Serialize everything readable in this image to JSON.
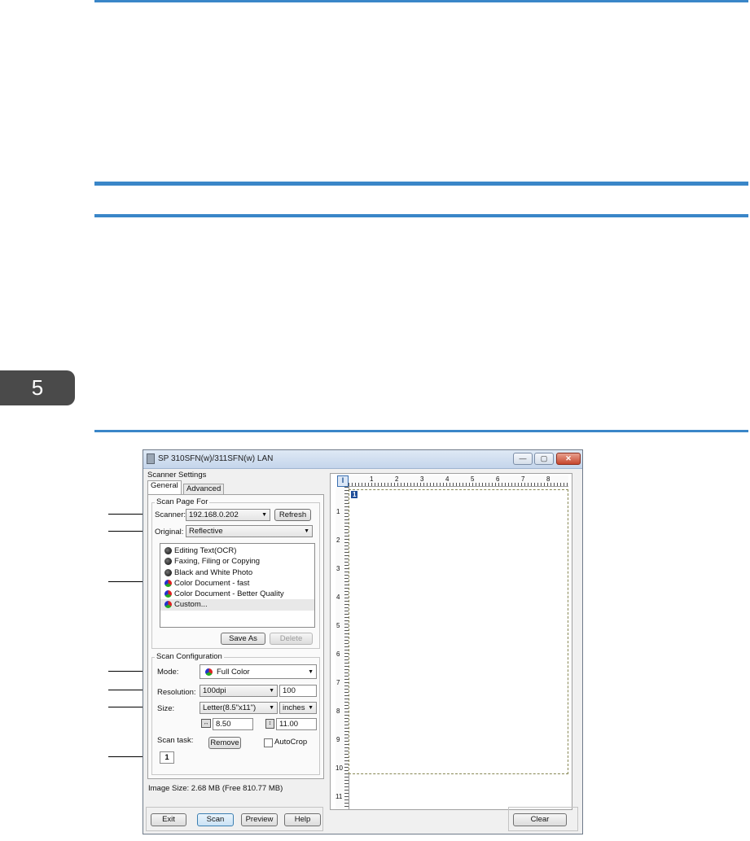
{
  "chapter": {
    "number": "5"
  },
  "window": {
    "title": "SP 310SFN(w)/311SFN(w) LAN",
    "buttons": {
      "minimize": "—",
      "maximize": "▢",
      "close": "✕"
    }
  },
  "scanner_settings": {
    "label": "Scanner Settings",
    "tabs": [
      "General",
      "Advanced"
    ],
    "scan_page_for": {
      "title": "Scan Page For",
      "scanner_label": "Scanner:",
      "scanner_value": "192.168.0.202",
      "refresh_button": "Refresh",
      "original_label": "Original:",
      "original_value": "Reflective",
      "presets": [
        {
          "label": "Editing Text(OCR)",
          "icon": "bw-icon"
        },
        {
          "label": "Faxing, Filing or Copying",
          "icon": "bw-icon"
        },
        {
          "label": "Black and White Photo",
          "icon": "bw-photo-icon"
        },
        {
          "label": "Color Document - fast",
          "icon": "color-icon"
        },
        {
          "label": "Color Document - Better Quality",
          "icon": "color-icon"
        },
        {
          "label": "Custom...",
          "icon": "color-icon"
        }
      ],
      "save_as_button": "Save As",
      "delete_button": "Delete"
    },
    "scan_configuration": {
      "title": "Scan Configuration",
      "mode_label": "Mode:",
      "mode_value": "Full Color",
      "resolution_label": "Resolution:",
      "resolution_value": "100dpi",
      "resolution_number": "100",
      "size_label": "Size:",
      "size_value": "Letter(8.5\"x11\")",
      "unit_value": "inches",
      "width_value": "8.50",
      "height_value": "11.00",
      "scan_task_label": "Scan task:",
      "remove_button": "Remove",
      "autocrop_label": "AutoCrop",
      "task_number": "1"
    },
    "image_size": "Image Size: 2.68 MB (Free 810.77 MB)"
  },
  "preview": {
    "ruler_h_labels": [
      "1",
      "2",
      "3",
      "4",
      "5",
      "6",
      "7",
      "8"
    ],
    "ruler_v_labels": [
      "1",
      "2",
      "3",
      "4",
      "5",
      "6",
      "7",
      "8",
      "9",
      "10",
      "11"
    ],
    "page_marker": "1"
  },
  "footer": {
    "exit": "Exit",
    "scan": "Scan",
    "preview": "Preview",
    "help": "Help",
    "clear": "Clear"
  },
  "colors": {
    "accent_line": "#3a86c8",
    "chapter_tab": "#4a4a4a"
  }
}
